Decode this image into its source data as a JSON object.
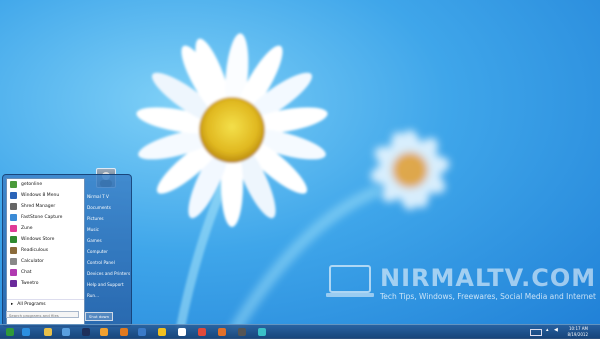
{
  "watermark": {
    "title": "NIRMALTV.COM",
    "subtitle": "Tech Tips, Windows, Freewares, Social Media and Internet"
  },
  "start_menu": {
    "programs": [
      {
        "label": "getonline",
        "color": "#4a9a3a"
      },
      {
        "label": "Windows 8 Menu",
        "color": "#2b64b8"
      },
      {
        "label": "Shred Manager",
        "color": "#666666"
      },
      {
        "label": "FastStone Capture",
        "color": "#3b8bd6"
      },
      {
        "label": "Zune",
        "color": "#e03a96"
      },
      {
        "label": "Windows Store",
        "color": "#2f8a2f"
      },
      {
        "label": "Readiculous",
        "color": "#8a6a3a"
      },
      {
        "label": "Calculator",
        "color": "#888888"
      },
      {
        "label": "Chat",
        "color": "#b03ab0"
      },
      {
        "label": "Tweetro",
        "color": "#6a2a9a"
      }
    ],
    "all_programs": "All Programs",
    "search_placeholder": "Search programs and files",
    "right_items": [
      "Nirmal T V",
      "Documents",
      "Pictures",
      "Music",
      "Games",
      "Computer",
      "Control Panel",
      "Devices and Printers",
      "Help and Support",
      "Run..."
    ],
    "shutdown_label": "Shut down"
  },
  "taskbar": {
    "apps": [
      {
        "name": "start-orb",
        "color": "#2f9a3a"
      },
      {
        "name": "ie-icon",
        "color": "#2b8fe0"
      },
      {
        "name": "folder-icon",
        "color": "#e8c04a"
      },
      {
        "name": "app-icon",
        "color": "#5aa0e0"
      },
      {
        "name": "photoshop-icon",
        "color": "#1e2f5a"
      },
      {
        "name": "media-player-icon",
        "color": "#f0a030"
      },
      {
        "name": "outlook-icon",
        "color": "#e07a20"
      },
      {
        "name": "network-icon",
        "color": "#3a7ac8"
      },
      {
        "name": "messenger-icon",
        "color": "#f0c020"
      },
      {
        "name": "sticky-icon",
        "color": "#ffffff"
      },
      {
        "name": "chrome-icon",
        "color": "#e04a3a"
      },
      {
        "name": "firefox-icon",
        "color": "#e0702a"
      },
      {
        "name": "camera-icon",
        "color": "#555555"
      },
      {
        "name": "tool-icon",
        "color": "#3ac0c8"
      }
    ],
    "time": "10:17 AM",
    "date": "8/19/2012"
  }
}
